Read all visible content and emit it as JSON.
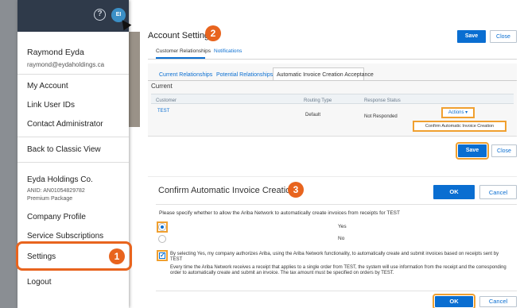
{
  "menu": {
    "user_name": "Raymond Eyda",
    "user_email": "raymond@eydaholdings.ca",
    "avatar_initials": "EI",
    "help_glyph": "?",
    "items": {
      "my_account": "My Account",
      "link_user_ids": "Link User IDs",
      "contact_admin": "Contact Administrator",
      "back_classic": "Back to Classic View",
      "company_profile": "Company Profile",
      "service_subscriptions": "Service Subscriptions",
      "settings": "Settings",
      "logout": "Logout"
    },
    "company": {
      "name": "Eyda Holdings Co.",
      "anid": "ANID: AN01054829782",
      "package": "Premium Package"
    }
  },
  "badges": {
    "one": "1",
    "two": "2",
    "three": "3"
  },
  "account_settings": {
    "title": "Account Settings",
    "save": "Save",
    "close": "Close",
    "top_tabs": [
      "Customer Relationships",
      "Notifications"
    ],
    "sub_tabs": [
      "Current Relationships",
      "Potential Relationships",
      "Automatic Invoice Creation Acceptance"
    ],
    "section": "Current",
    "columns": [
      "Customer",
      "Routing Type",
      "Response Status"
    ],
    "row": {
      "customer": "TEST",
      "routing": "Default",
      "status": "Not Responded"
    },
    "actions": "Actions ▾",
    "menu_item": "Confirm Automatic Invoice Creation"
  },
  "dialog": {
    "title": "Confirm Automatic Invoice Creation",
    "ok": "OK",
    "cancel": "Cancel",
    "question": "Please specify whether to allow the Ariba Network to automatically create invoices from receipts for  TEST",
    "yes": "Yes",
    "no": "No",
    "disclaimer_1": "By selecting Yes, my company authorizes Ariba, using the Ariba Network functionality, to automatically create and submit invoices based on receipts sent by TEST",
    "disclaimer_2": "Every time the Ariba Network receives a receipt that applies to a single order from TEST, the system will use information from the receipt and the corresponding order to automatically create and submit an invoice. The tax amount must be specified on orders by TEST."
  },
  "colors": {
    "accent": "#0a6ed1",
    "highlight": "#f0a030",
    "badge": "#e8641e",
    "header": "#2f3a4a"
  }
}
